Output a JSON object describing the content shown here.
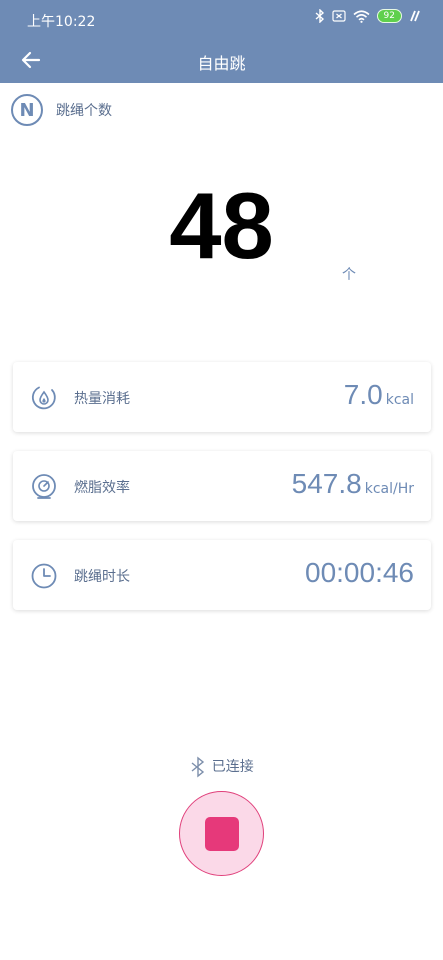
{
  "status_bar": {
    "time": "上午10:22",
    "battery": "92",
    "icons": [
      "bluetooth-icon",
      "sim-icon",
      "wifi-icon",
      "battery-icon",
      "charging-icon"
    ]
  },
  "nav": {
    "title": "自由跳",
    "back_icon": "arrow-left-icon"
  },
  "mode": {
    "badge": "N",
    "label": "跳绳个数"
  },
  "counter": {
    "value": "48",
    "unit": "个"
  },
  "stats": [
    {
      "label": "热量消耗",
      "value": "7.0",
      "unit": "kcal",
      "icon": "calorie-icon"
    },
    {
      "label": "燃脂效率",
      "value": "547.8",
      "unit": "kcal/Hr",
      "icon": "fat-burn-icon"
    },
    {
      "label": "跳绳时长",
      "value": "00:00:46",
      "unit": "",
      "icon": "clock-icon"
    }
  ],
  "connection": {
    "status": "已连接",
    "icon": "bluetooth-icon"
  },
  "controls": {
    "stop_icon": "stop-icon"
  },
  "colors": {
    "header": "#6e8bb5",
    "text": "#5b6f8f",
    "stop_accent": "#e6397a",
    "stop_bg": "#fbd9e8"
  }
}
